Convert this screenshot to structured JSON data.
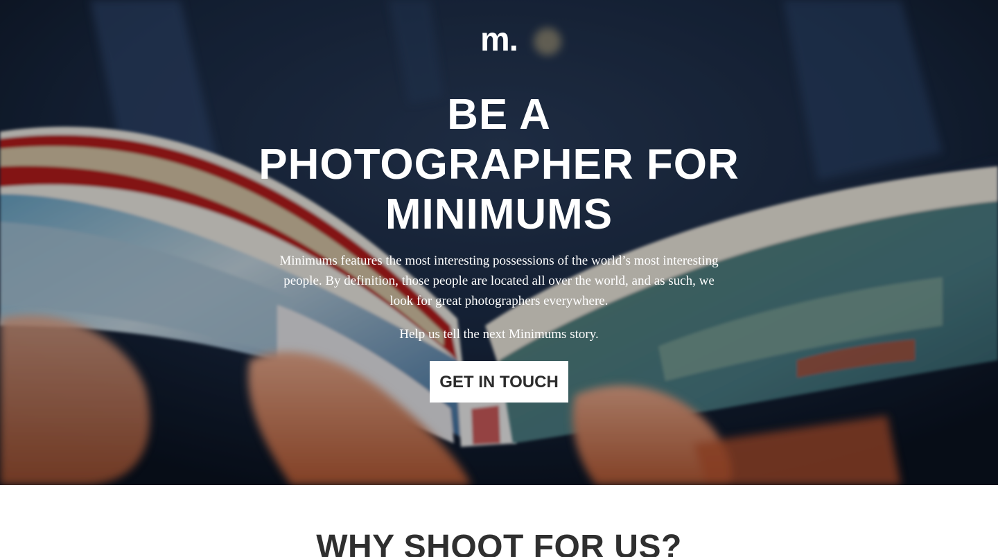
{
  "hero": {
    "logo": "m.",
    "headline": [
      "BE A",
      "PHOTOGRAPHER FOR",
      "MINIMUMS"
    ],
    "description": "Minimums features the most interesting possessions of the world’s most interesting people. By definition, those people are located all over the world, and as such, we look for great photographers everywhere.",
    "help_text": "Help us tell the next Minimums story.",
    "cta_label": "GET IN TOUCH",
    "background_image": "open-book-held-in-hands"
  },
  "why_section": {
    "title": "WHY SHOOT FOR US?"
  },
  "colors": {
    "text_light": "#ffffff",
    "button_bg": "#ffffff",
    "button_text": "#2b2b2b",
    "section_title": "#2f2f2f"
  }
}
